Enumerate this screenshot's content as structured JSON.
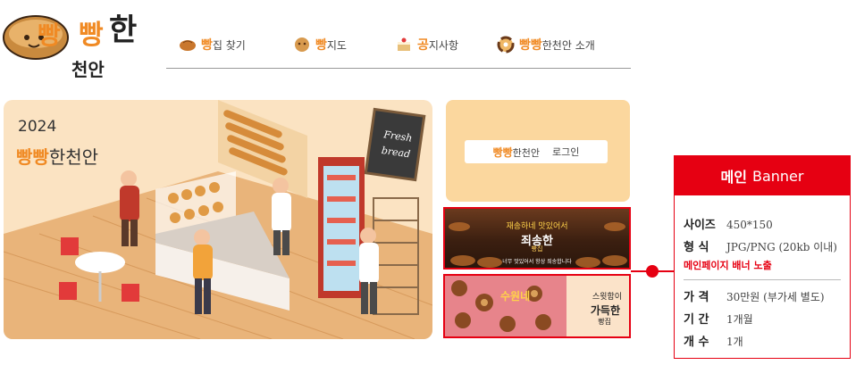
{
  "logo": {
    "line1_a": "빵",
    "line1_b": "빵",
    "line1_c": "한",
    "line2": "천안"
  },
  "nav": {
    "items": [
      {
        "highlight": "빵",
        "rest": "집 찾기"
      },
      {
        "highlight": "빵",
        "rest": " 지도"
      },
      {
        "highlight": "공",
        "rest": "지사항"
      },
      {
        "highlight": "빵빵",
        "rest": "한천안 소개"
      }
    ]
  },
  "main_banner": {
    "year": "2024",
    "title_highlight": "빵빵",
    "title_rest": "한천안",
    "sign_line1": "Fresh",
    "sign_line2": "bread"
  },
  "login": {
    "brand_highlight": "빵빵",
    "brand_rest": "한천안",
    "action": "로그인"
  },
  "ad1": {
    "top": "재송하네 맛있어서",
    "main": "죄송한",
    "sub": "빵집",
    "foot": "너무 맛있어서 항상 죄송합니다"
  },
  "ad2": {
    "tag": "수원네",
    "line1": "스윗함이",
    "line2": "가득한",
    "line3": "빵집"
  },
  "spec": {
    "title_bold": "메인",
    "title_rest": "Banner",
    "rows": [
      {
        "key": "사이즈",
        "value": "450*150"
      },
      {
        "key": "형  식",
        "value": "JPG/PNG (20kb 이내)"
      }
    ],
    "note": "메인페이지 배너 노출",
    "rows2": [
      {
        "key": "가  격",
        "value": "30만원 (부가세 별도)"
      },
      {
        "key": "기  간",
        "value": "1개월"
      },
      {
        "key": "개  수",
        "value": "1개"
      }
    ]
  },
  "colors": {
    "accent": "#f08a24",
    "red": "#e60012",
    "banner_bg": "#fbe3c2",
    "login_bg": "#fbd79e"
  }
}
